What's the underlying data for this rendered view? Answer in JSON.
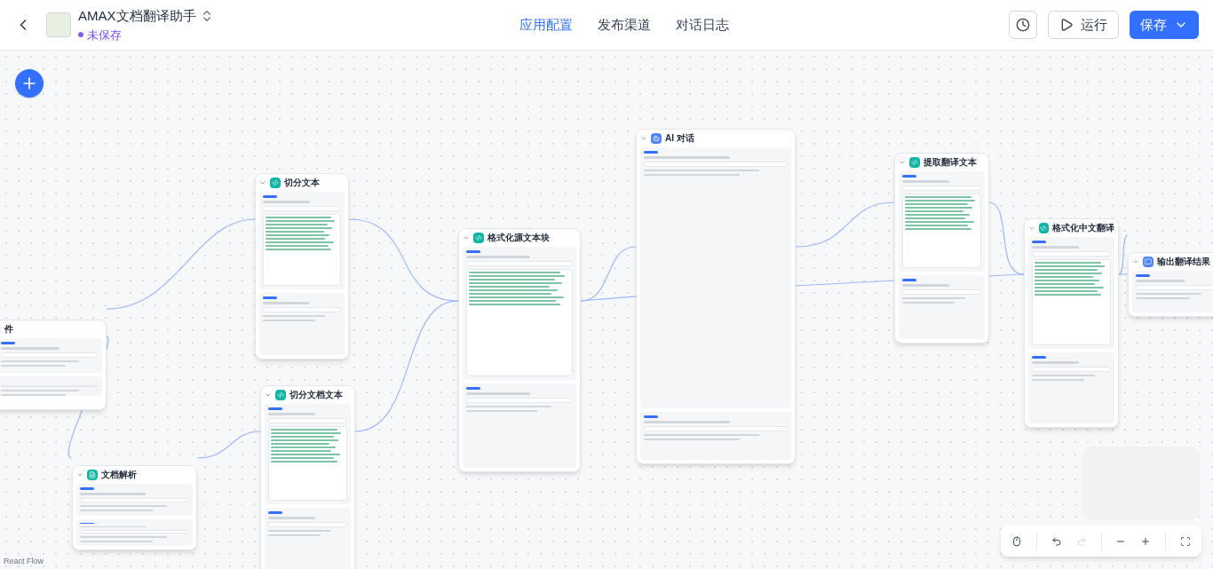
{
  "header": {
    "app_name": "AMAX文档翻译助手",
    "status": "未保存",
    "tabs": [
      {
        "label": "应用配置",
        "selected": true
      },
      {
        "label": "发布渠道",
        "selected": false
      },
      {
        "label": "对话日志",
        "selected": false
      }
    ],
    "run_button": "运行",
    "save_button": "保存"
  },
  "nodes": [
    {
      "kind": "condition",
      "title": "件"
    },
    {
      "kind": "code",
      "title": "切分文本"
    },
    {
      "kind": "code",
      "title": "切分文档文本"
    },
    {
      "kind": "parser",
      "title": "文档解析"
    },
    {
      "kind": "code",
      "title": "格式化源文本块"
    },
    {
      "kind": "ai",
      "title": "AI 对话"
    },
    {
      "kind": "code",
      "title": "提取翻译文本"
    },
    {
      "kind": "code",
      "title": "格式化中文翻译"
    },
    {
      "kind": "reply",
      "title": "输出翻译结果"
    }
  ],
  "attribution": "React Flow"
}
